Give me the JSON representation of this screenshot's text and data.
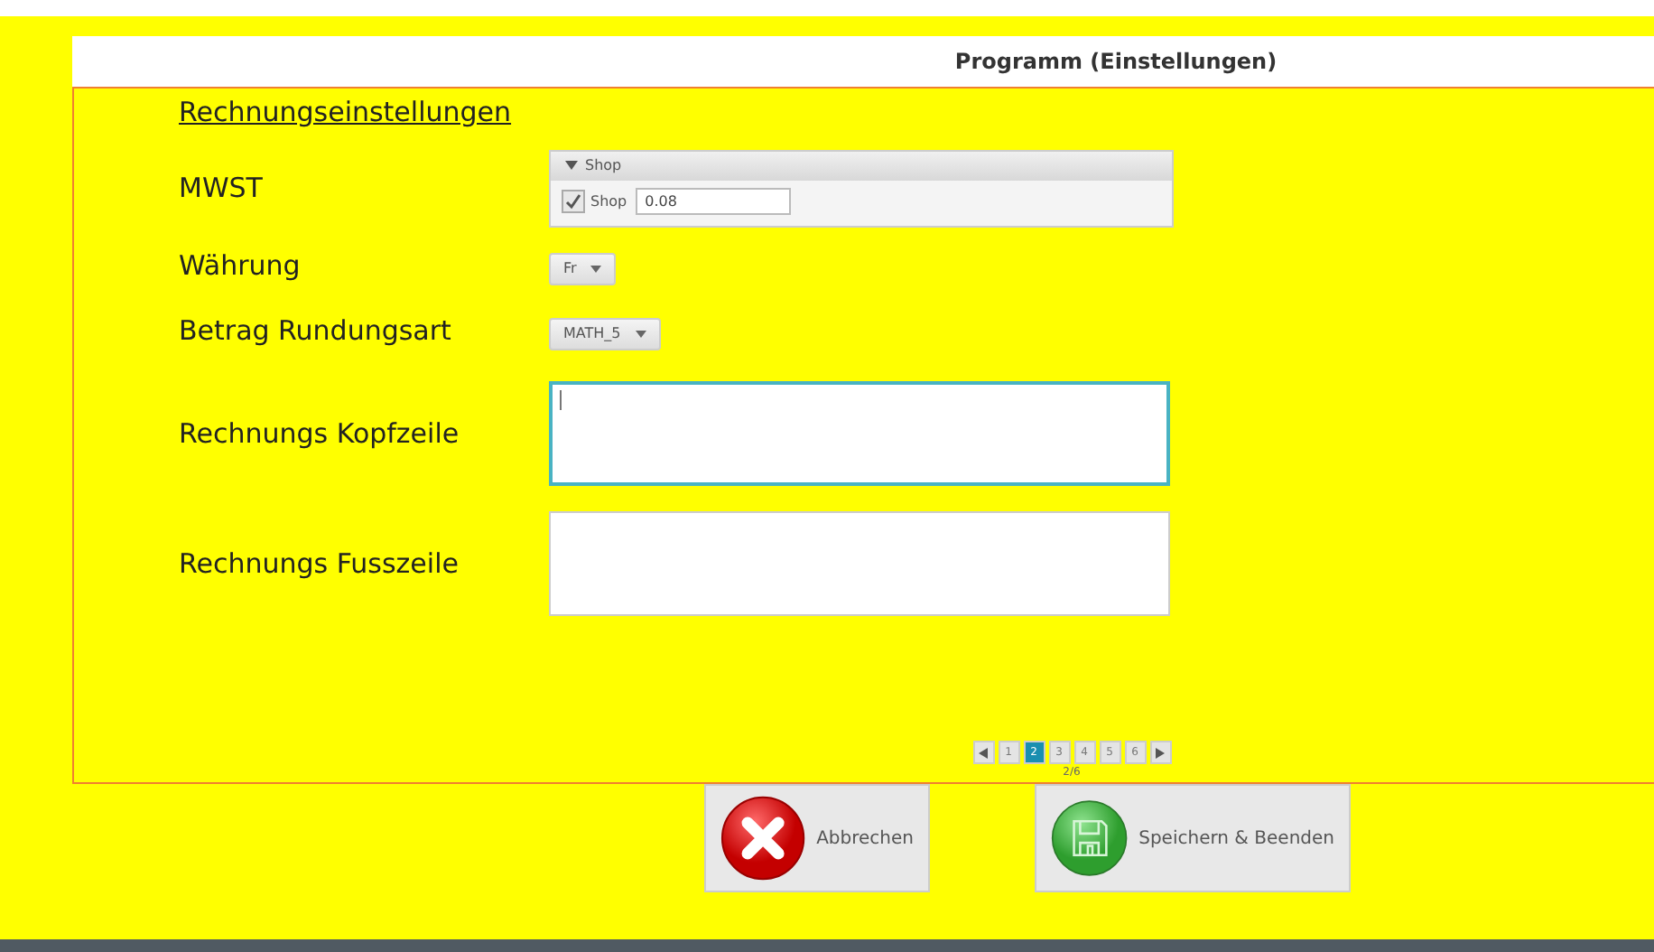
{
  "title": "Programm (Einstellungen)",
  "section": "Rechnungseinstellungen",
  "rows": [
    {
      "kind": "accordion",
      "label": "MWST",
      "header": "Shop",
      "expanded": true,
      "item": {
        "label": "Shop",
        "checked": true,
        "value": "0.08"
      }
    },
    {
      "kind": "combo",
      "label": "Währung",
      "value": "Fr"
    },
    {
      "kind": "combo",
      "label": "Betrag Rundungsart",
      "value": "MATH_5"
    },
    {
      "kind": "textarea",
      "label": "Rechnungs Kopfzeile",
      "focused": true
    },
    {
      "kind": "textarea",
      "label": "Rechnungs Fusszeile",
      "focused": false
    }
  ],
  "pagination": {
    "pages": [
      {
        "label": "1",
        "selected": false
      },
      {
        "label": "2",
        "selected": true
      },
      {
        "label": "3",
        "selected": false
      },
      {
        "label": "4",
        "selected": false
      },
      {
        "label": "5",
        "selected": false
      },
      {
        "label": "6",
        "selected": false
      }
    ],
    "status": "2/6"
  },
  "buttons": [
    {
      "kind": "cancel",
      "label": "Abbrechen"
    },
    {
      "kind": "save",
      "label": "Speichern & Beenden"
    }
  ]
}
